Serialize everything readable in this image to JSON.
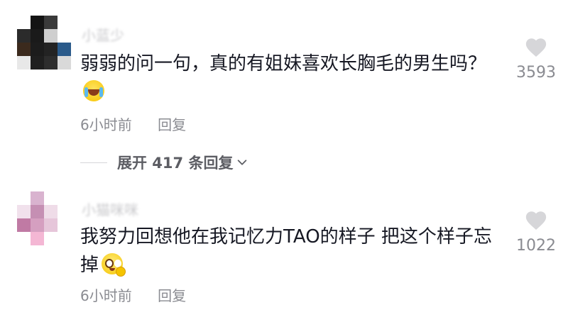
{
  "comments": [
    {
      "username": "小蓝少",
      "text": "弱弱的问一句，真的有姐妹喜欢长胸毛的男生吗？",
      "emoji_icon": "crying-face-icon",
      "time": "6小时前",
      "reply_label": "回复",
      "likes": "3593",
      "avatar_colors": [
        "#ffffff",
        "#141414",
        "#3a3a3a",
        "#ffffff",
        "#2b2b2b",
        "#1a1a1a",
        "#cfcfcf",
        "#ffffff",
        "#3b2a1d",
        "#1c1c1c",
        "#232323",
        "#2a5a8a",
        "#e8e8e8",
        "#1f1f1f",
        "#2d2d2d",
        "#d9d9d9"
      ]
    },
    {
      "username": "小猫咪咪",
      "text": "我努力回想他在我记忆力TAO的样子   把这个样子忘掉",
      "emoji_icon": "puppy-eyes-face-icon",
      "time": "6小时前",
      "reply_label": "回复",
      "likes": "1022",
      "avatar_colors": [
        "#ffffff",
        "#d9b3cf",
        "#ffffff",
        "#ffffff",
        "#f1e1ec",
        "#c58fb3",
        "#efdce8",
        "#ffffff",
        "#c07aa4",
        "#d59fc0",
        "#e6c6da",
        "#ffffff",
        "#ffffff",
        "#f4b7d4",
        "#ffffff",
        "#ffffff"
      ]
    }
  ],
  "expand_replies": {
    "label": "展开 417 条回复",
    "icon": "chevron-down-icon"
  },
  "colors": {
    "text": "#161823",
    "meta": "#8a8b91",
    "heart": "#d6d6d9"
  }
}
